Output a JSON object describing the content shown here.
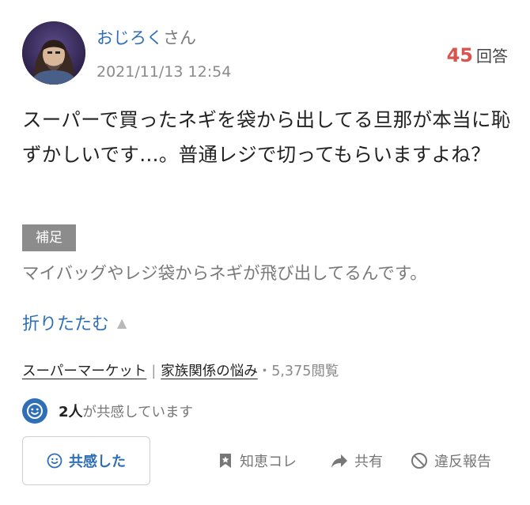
{
  "author": {
    "name": "おじろく",
    "suffix": "さん",
    "date": "2021/11/13 12:54"
  },
  "answers": {
    "count": "45",
    "label": "回答"
  },
  "question": {
    "text": "スーパーで買ったネギを袋から出してる旦那が本当に恥ずかしいです…。普通レジで切ってもらいますよね？"
  },
  "supplement": {
    "tag": "補足",
    "text": "マイバッグやレジ袋からネギが飛び出してるんです。"
  },
  "collapse": {
    "label": "折りたたむ"
  },
  "categories": {
    "primary": "スーパーマーケット",
    "separator": "|",
    "secondary": "家族関係の悩み",
    "views": "・5,375閲覧"
  },
  "empathy": {
    "count": "2人",
    "label": "が共感しています",
    "button_label": "共感した"
  },
  "actions": {
    "chiekore": "知恵コレ",
    "share": "共有",
    "report": "違反報告"
  },
  "colors": {
    "accent": "#2f6fb5",
    "answers_count": "#d9534f"
  }
}
